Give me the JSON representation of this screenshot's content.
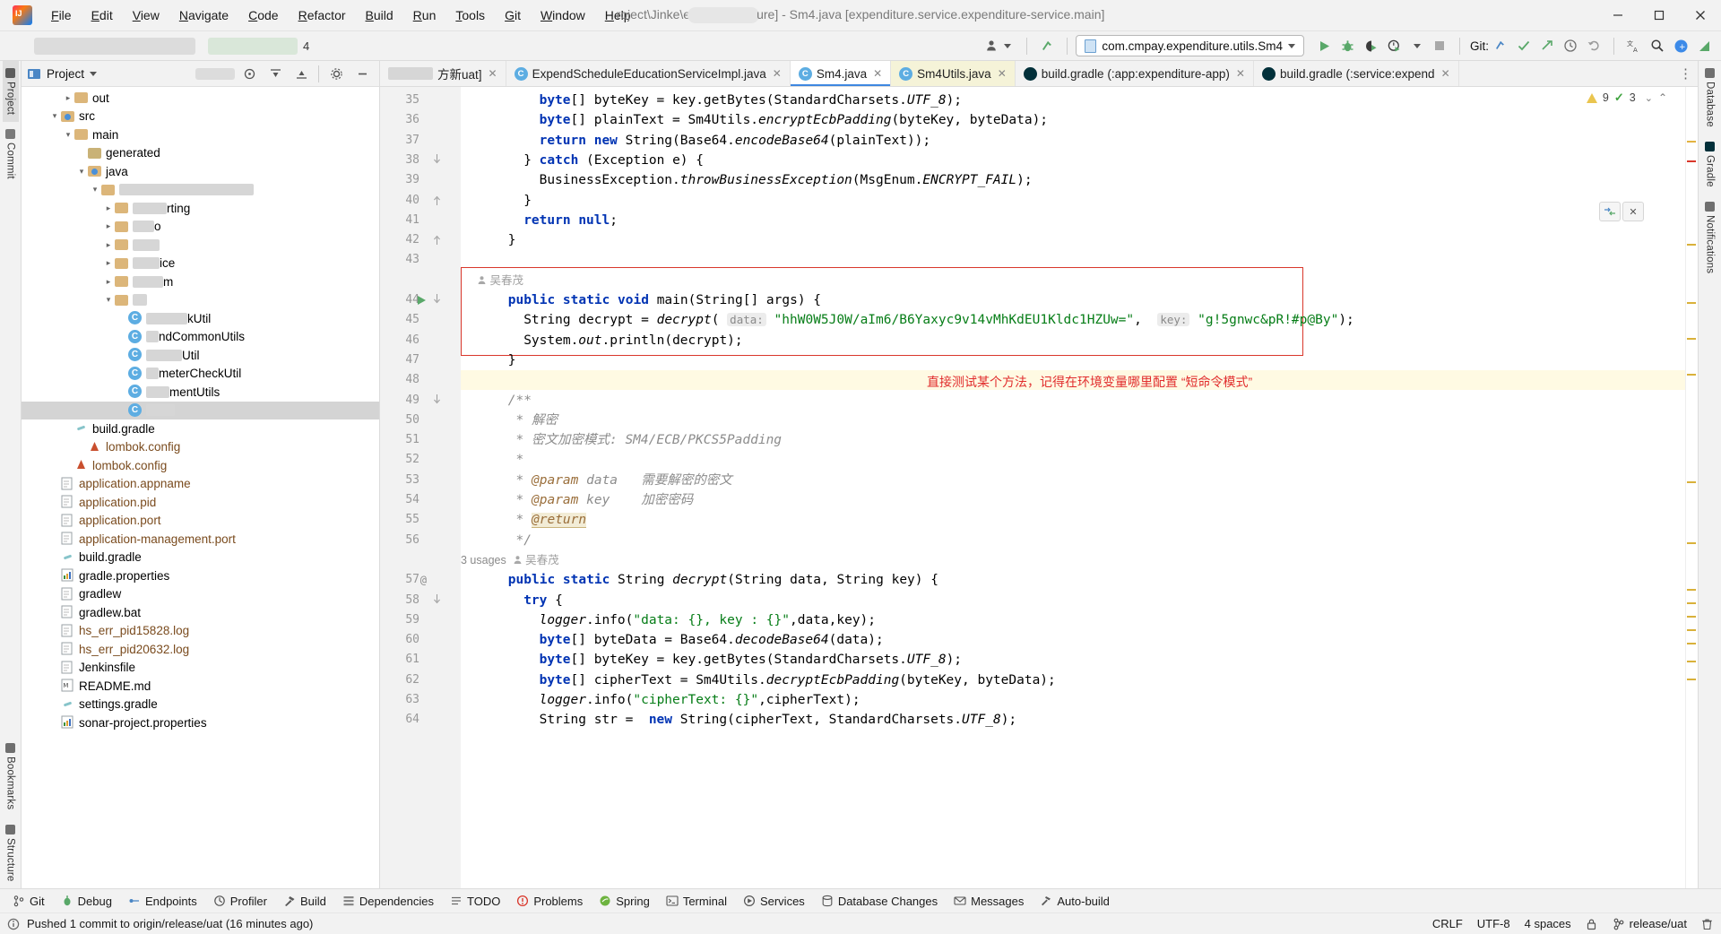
{
  "window": {
    "title_prefix": "roject\\Jinke\\e",
    "title_mid": "ure] - Sm4.java [expenditure.service.expenditure-service.main]",
    "minimize": "—",
    "maximize": "▢",
    "close": "✕"
  },
  "menubar": {
    "items": [
      "File",
      "Edit",
      "View",
      "Navigate",
      "Code",
      "Refactor",
      "Build",
      "Run",
      "Tools",
      "Git",
      "Window",
      "Help"
    ]
  },
  "toolbar": {
    "run_config": "com.cmpay.expenditure.utils.Sm4",
    "git_label": "Git:",
    "run_icon": "run-icon",
    "debug_icon": "debug-icon",
    "coverage_icon": "run-with-coverage-icon",
    "profiler_icon": "profiler-icon",
    "stop_icon": "stop-icon",
    "search_icon": "search-icon",
    "settings_icon": "settings-icon",
    "translate_icon": "translate-icon",
    "update_icon": "update-project-icon",
    "commit_icon": "commit-icon",
    "push_icon": "push-icon",
    "history_icon": "history-icon",
    "rollback_icon": "rollback-icon"
  },
  "project_pane": {
    "title": "Project",
    "tree": [
      {
        "indent": 3,
        "arrow": "▸",
        "icon": "folder",
        "label": "out",
        "color": "plain"
      },
      {
        "indent": 2,
        "arrow": "▾",
        "icon": "folder-src",
        "label": "src",
        "color": "plain"
      },
      {
        "indent": 3,
        "arrow": "▾",
        "icon": "folder",
        "label": "main",
        "color": "plain"
      },
      {
        "indent": 4,
        "arrow": "",
        "icon": "folder-gen",
        "label": "generated",
        "color": "plain"
      },
      {
        "indent": 4,
        "arrow": "▾",
        "icon": "folder-src",
        "label": "java",
        "color": "plain"
      },
      {
        "indent": 5,
        "arrow": "▾",
        "icon": "folder",
        "label": "",
        "color": "blurred",
        "blur": 150
      },
      {
        "indent": 6,
        "arrow": "▸",
        "icon": "folder",
        "label": "rting",
        "color": "plain",
        "blurlead": 38
      },
      {
        "indent": 6,
        "arrow": "▸",
        "icon": "folder",
        "label": "o",
        "color": "plain",
        "blurlead": 24
      },
      {
        "indent": 6,
        "arrow": "▸",
        "icon": "folder",
        "label": "",
        "color": "plain",
        "blurlead": 30
      },
      {
        "indent": 6,
        "arrow": "▸",
        "icon": "folder",
        "label": "ice",
        "color": "plain",
        "blurlead": 30
      },
      {
        "indent": 6,
        "arrow": "▸",
        "icon": "folder",
        "label": "m",
        "color": "plain",
        "blurlead": 34
      },
      {
        "indent": 6,
        "arrow": "▾",
        "icon": "folder",
        "label": "",
        "color": "plain",
        "blurlead": 16
      },
      {
        "indent": 7,
        "arrow": "",
        "icon": "class",
        "label": "kUtil",
        "color": "plain",
        "blurlead": 46
      },
      {
        "indent": 7,
        "arrow": "",
        "icon": "class",
        "label": "ndCommonUtils",
        "color": "plain",
        "blurlead": 14
      },
      {
        "indent": 7,
        "arrow": "",
        "icon": "class",
        "label": "Util",
        "color": "plain",
        "blurlead": 40
      },
      {
        "indent": 7,
        "arrow": "",
        "icon": "class",
        "label": "meterCheckUtil",
        "color": "plain",
        "blurlead": 14
      },
      {
        "indent": 7,
        "arrow": "",
        "icon": "class",
        "label": "mentUtils",
        "color": "plain",
        "blurlead": 26
      },
      {
        "indent": 7,
        "arrow": "",
        "icon": "class",
        "label": "",
        "color": "selected",
        "blurlead": 32
      },
      {
        "indent": 3,
        "arrow": "",
        "icon": "gradle",
        "label": "build.gradle",
        "color": "plain"
      },
      {
        "indent": 4,
        "arrow": "",
        "icon": "lombok",
        "label": "lombok.config",
        "color": "brown"
      },
      {
        "indent": 3,
        "arrow": "",
        "icon": "lombok",
        "label": "lombok.config",
        "color": "brown"
      },
      {
        "indent": 2,
        "arrow": "",
        "icon": "file",
        "label": "application.appname",
        "color": "brown"
      },
      {
        "indent": 2,
        "arrow": "",
        "icon": "file",
        "label": "application.pid",
        "color": "brown"
      },
      {
        "indent": 2,
        "arrow": "",
        "icon": "file",
        "label": "application.port",
        "color": "brown"
      },
      {
        "indent": 2,
        "arrow": "",
        "icon": "file",
        "label": "application-management.port",
        "color": "brown"
      },
      {
        "indent": 2,
        "arrow": "",
        "icon": "gradle",
        "label": "build.gradle",
        "color": "plain"
      },
      {
        "indent": 2,
        "arrow": "",
        "icon": "chart",
        "label": "gradle.properties",
        "color": "plain"
      },
      {
        "indent": 2,
        "arrow": "",
        "icon": "file",
        "label": "gradlew",
        "color": "plain"
      },
      {
        "indent": 2,
        "arrow": "",
        "icon": "file",
        "label": "gradlew.bat",
        "color": "plain"
      },
      {
        "indent": 2,
        "arrow": "",
        "icon": "file",
        "label": "hs_err_pid15828.log",
        "color": "brown"
      },
      {
        "indent": 2,
        "arrow": "",
        "icon": "file",
        "label": "hs_err_pid20632.log",
        "color": "brown"
      },
      {
        "indent": 2,
        "arrow": "",
        "icon": "file",
        "label": "Jenkinsfile",
        "color": "plain"
      },
      {
        "indent": 2,
        "arrow": "",
        "icon": "md",
        "label": "README.md",
        "color": "plain"
      },
      {
        "indent": 2,
        "arrow": "",
        "icon": "gradle",
        "label": "settings.gradle",
        "color": "plain"
      },
      {
        "indent": 2,
        "arrow": "",
        "icon": "chart",
        "label": "sonar-project.properties",
        "color": "plain"
      }
    ]
  },
  "left_rail": {
    "items": [
      "Project",
      "Commit"
    ],
    "bottom_items": [
      "Bookmarks",
      "Structure"
    ]
  },
  "right_rail": {
    "items": [
      "Database",
      "Gradle",
      "Notifications"
    ]
  },
  "tabs": [
    {
      "label": "方新uat]",
      "icon": "blurred-tab-icon",
      "closable": true,
      "state": "blurred"
    },
    {
      "label": "ExpendScheduleEducationServiceImpl.java",
      "icon": "java-class-icon",
      "closable": true,
      "state": "normal"
    },
    {
      "label": "Sm4.java",
      "icon": "java-runnable-class-icon",
      "closable": true,
      "state": "active"
    },
    {
      "label": "Sm4Utils.java",
      "icon": "java-class-icon",
      "closable": true,
      "state": "modified"
    },
    {
      "label": "build.gradle (:app:expenditure-app)",
      "icon": "gradle-icon",
      "closable": false,
      "state": "normal"
    },
    {
      "label": "build.gradle (:service:expend",
      "icon": "gradle-icon",
      "closable": false,
      "state": "normal"
    }
  ],
  "inspection": {
    "warnings": "9",
    "errors": "3",
    "warn_icon": "warning-triangle-icon",
    "err_icon": "checkmark-icon"
  },
  "editor": {
    "first_line": 35,
    "author_label": "吴春茂",
    "usages_label": "3 usages",
    "red_note": "直接测试某个方法，记得在环境变量哪里配置 “短命令模式”",
    "lines": [
      {
        "n": 35,
        "indent": 8,
        "tokens": [
          {
            "t": "byte",
            "c": "k"
          },
          {
            "t": "[] byteKey = key.getBytes(StandardCharsets."
          },
          {
            "t": "UTF_8",
            "c": "it"
          },
          {
            "t": ");"
          }
        ]
      },
      {
        "n": 36,
        "indent": 8,
        "tokens": [
          {
            "t": "byte",
            "c": "k"
          },
          {
            "t": "[] plainText = Sm4Utils."
          },
          {
            "t": "encryptEcbPadding",
            "c": "it"
          },
          {
            "t": "(byteKey, byteData);"
          }
        ]
      },
      {
        "n": 37,
        "indent": 8,
        "tokens": [
          {
            "t": "return",
            "c": "k"
          },
          {
            "t": " "
          },
          {
            "t": "new",
            "c": "k"
          },
          {
            "t": " String(Base64."
          },
          {
            "t": "encodeBase64",
            "c": "it"
          },
          {
            "t": "(plainText));"
          }
        ]
      },
      {
        "n": 38,
        "indent": 6,
        "tokens": [
          {
            "t": "} "
          },
          {
            "t": "catch",
            "c": "k"
          },
          {
            "t": " (Exception e) {"
          }
        ]
      },
      {
        "n": 39,
        "indent": 8,
        "tokens": [
          {
            "t": "BusinessException."
          },
          {
            "t": "throwBusinessException",
            "c": "it"
          },
          {
            "t": "(MsgEnum."
          },
          {
            "t": "ENCRYPT_FAIL",
            "c": "it"
          },
          {
            "t": ");"
          }
        ]
      },
      {
        "n": 40,
        "indent": 6,
        "tokens": [
          {
            "t": "}"
          }
        ]
      },
      {
        "n": 41,
        "indent": 6,
        "tokens": [
          {
            "t": "return",
            "c": "k"
          },
          {
            "t": " "
          },
          {
            "t": "null",
            "c": "k"
          },
          {
            "t": ";"
          }
        ]
      },
      {
        "n": 42,
        "indent": 4,
        "tokens": [
          {
            "t": "}"
          }
        ]
      },
      {
        "n": 43,
        "indent": 0,
        "tokens": []
      },
      {
        "n": 44,
        "indent": 4,
        "tokens": [
          {
            "t": "public",
            "c": "k"
          },
          {
            "t": " "
          },
          {
            "t": "static",
            "c": "k"
          },
          {
            "t": " "
          },
          {
            "t": "void",
            "c": "k"
          },
          {
            "t": " main(String[] args) {"
          }
        ]
      },
      {
        "n": 45,
        "indent": 6,
        "tokens": [
          {
            "t": "String decrypt = "
          },
          {
            "t": "decrypt",
            "c": "it"
          },
          {
            "t": "( "
          },
          {
            "t": "data:",
            "c": "hint"
          },
          {
            "t": " \"hhW0W5J0W/aIm6/B6Yaxyc9v14vMhKdEU1Kldc1HZUw=\"",
            "c": "s"
          },
          {
            "t": ",  "
          },
          {
            "t": "key:",
            "c": "hint"
          },
          {
            "t": " \"g!5gnwc&pR!#p@By\"",
            "c": "s"
          },
          {
            "t": ");"
          }
        ]
      },
      {
        "n": 46,
        "indent": 6,
        "tokens": [
          {
            "t": "System."
          },
          {
            "t": "out",
            "c": "it"
          },
          {
            "t": ".println(decrypt);"
          }
        ]
      },
      {
        "n": 47,
        "indent": 4,
        "tokens": [
          {
            "t": "}"
          }
        ]
      },
      {
        "n": 48,
        "indent": 0,
        "tokens": []
      },
      {
        "n": 49,
        "indent": 4,
        "tokens": [
          {
            "t": "/**",
            "c": "c"
          }
        ]
      },
      {
        "n": 50,
        "indent": 4,
        "tokens": [
          {
            "t": " * 解密",
            "c": "c"
          }
        ]
      },
      {
        "n": 51,
        "indent": 4,
        "tokens": [
          {
            "t": " * 密文加密模式: SM4/ECB/PKCS5Padding",
            "c": "c"
          }
        ]
      },
      {
        "n": 52,
        "indent": 4,
        "tokens": [
          {
            "t": " *",
            "c": "c"
          }
        ]
      },
      {
        "n": 53,
        "indent": 4,
        "tokens": [
          {
            "t": " * ",
            "c": "c"
          },
          {
            "t": "@param",
            "c": "ctag"
          },
          {
            "t": " data",
            "c": "c"
          },
          {
            "t": "   需要解密的密文",
            "c": "c"
          }
        ]
      },
      {
        "n": 54,
        "indent": 4,
        "tokens": [
          {
            "t": " * ",
            "c": "c"
          },
          {
            "t": "@param",
            "c": "ctag"
          },
          {
            "t": " key",
            "c": "c"
          },
          {
            "t": "    加密密码",
            "c": "c"
          }
        ]
      },
      {
        "n": 55,
        "indent": 4,
        "tokens": [
          {
            "t": " * ",
            "c": "c"
          },
          {
            "t": "@return",
            "c": "ctag-hl"
          }
        ]
      },
      {
        "n": 56,
        "indent": 4,
        "tokens": [
          {
            "t": " */",
            "c": "c"
          }
        ]
      },
      {
        "n": 57,
        "indent": 4,
        "tokens": [
          {
            "t": "public",
            "c": "k"
          },
          {
            "t": " "
          },
          {
            "t": "static",
            "c": "k"
          },
          {
            "t": " String "
          },
          {
            "t": "decrypt",
            "c": "it"
          },
          {
            "t": "(String data, String key) {"
          }
        ]
      },
      {
        "n": 58,
        "indent": 6,
        "tokens": [
          {
            "t": "try",
            "c": "k"
          },
          {
            "t": " {"
          }
        ]
      },
      {
        "n": 59,
        "indent": 8,
        "tokens": [
          {
            "t": "logger",
            "c": "it"
          },
          {
            "t": ".info("
          },
          {
            "t": "\"data: {}, key : {}\"",
            "c": "s"
          },
          {
            "t": ",data,key);"
          }
        ]
      },
      {
        "n": 60,
        "indent": 8,
        "tokens": [
          {
            "t": "byte",
            "c": "k"
          },
          {
            "t": "[] byteData = Base64."
          },
          {
            "t": "decodeBase64",
            "c": "it"
          },
          {
            "t": "(data);"
          }
        ]
      },
      {
        "n": 61,
        "indent": 8,
        "tokens": [
          {
            "t": "byte",
            "c": "k"
          },
          {
            "t": "[] byteKey = key.getBytes(StandardCharsets."
          },
          {
            "t": "UTF_8",
            "c": "it"
          },
          {
            "t": ");"
          }
        ]
      },
      {
        "n": 62,
        "indent": 8,
        "tokens": [
          {
            "t": "byte",
            "c": "k"
          },
          {
            "t": "[] cipherText = Sm4Utils."
          },
          {
            "t": "decryptEcbPadding",
            "c": "it"
          },
          {
            "t": "(byteKey, byteData);"
          }
        ]
      },
      {
        "n": 63,
        "indent": 8,
        "tokens": [
          {
            "t": "logger",
            "c": "it"
          },
          {
            "t": ".info("
          },
          {
            "t": "\"cipherText: {}\"",
            "c": "s"
          },
          {
            "t": ",cipherText);"
          }
        ]
      },
      {
        "n": 64,
        "indent": 8,
        "tokens": [
          {
            "t": "String str =  "
          },
          {
            "t": "new",
            "c": "k"
          },
          {
            "t": " String(cipherText, StandardCharsets."
          },
          {
            "t": "UTF_8",
            "c": "it"
          },
          {
            "t": ");"
          }
        ]
      }
    ]
  },
  "bottom_bar": {
    "items": [
      {
        "label": "Git",
        "icon": "git-icon"
      },
      {
        "label": "Debug",
        "icon": "debug-icon"
      },
      {
        "label": "Endpoints",
        "icon": "endpoints-icon"
      },
      {
        "label": "Profiler",
        "icon": "profiler-icon"
      },
      {
        "label": "Build",
        "icon": "build-hammer-icon"
      },
      {
        "label": "Dependencies",
        "icon": "dependencies-icon"
      },
      {
        "label": "TODO",
        "icon": "todo-icon"
      },
      {
        "label": "Problems",
        "icon": "problems-icon"
      },
      {
        "label": "Spring",
        "icon": "spring-icon"
      },
      {
        "label": "Terminal",
        "icon": "terminal-icon"
      },
      {
        "label": "Services",
        "icon": "services-icon"
      },
      {
        "label": "Database Changes",
        "icon": "database-changes-icon"
      },
      {
        "label": "Messages",
        "icon": "messages-icon"
      },
      {
        "label": "Auto-build",
        "icon": "auto-build-icon"
      }
    ]
  },
  "status_bar": {
    "message": "Pushed 1 commit to origin/release/uat (16 minutes ago)",
    "line_sep": "CRLF",
    "encoding": "UTF-8",
    "indent": "4 spaces",
    "branch": "release/uat",
    "lock_icon": "lock-icon",
    "branch_icon": "git-branch-icon"
  },
  "colors": {
    "accent": "#3e87e0",
    "keyword": "#0033b3",
    "string": "#067d17",
    "comment": "#8c8c8c",
    "red_annotation": "#e12d2d",
    "selection": "#d4d4d4"
  }
}
